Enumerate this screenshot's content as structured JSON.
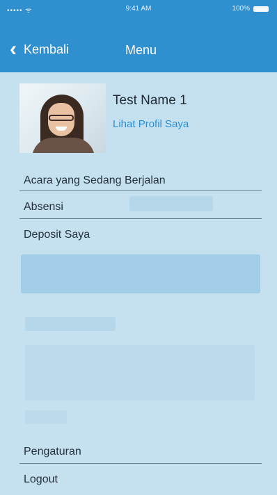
{
  "status_bar": {
    "signal": "••••• ᯤ",
    "time": "9:41 AM",
    "battery": "100%"
  },
  "nav": {
    "back_label": "Kembali",
    "title": "Menu"
  },
  "profile": {
    "name": "Test Name 1",
    "link": "Lihat Profil Saya"
  },
  "menu": {
    "items": [
      "Acara yang Sedang Berjalan",
      "Absensi",
      "Deposit Saya"
    ],
    "bottom_items": [
      "Pengaturan",
      "Logout"
    ]
  },
  "colors": {
    "accent": "#2f8fcf",
    "overlay": "#c5e0ef",
    "link": "#2a8ed4"
  }
}
